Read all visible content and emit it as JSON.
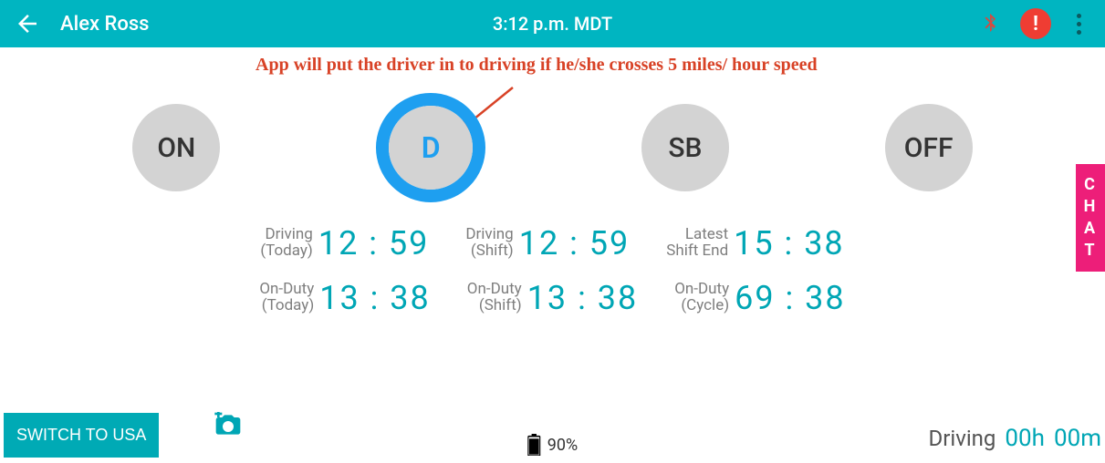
{
  "header": {
    "driver_name": "Alex Ross",
    "clock": "3:12 p.m. MDT"
  },
  "annotation": "App will put the driver in to driving if he/she crosses 5 miles/ hour speed",
  "status_buttons": {
    "on": "ON",
    "d": "D",
    "sb": "SB",
    "off": "OFF"
  },
  "times_row1": [
    {
      "label_line1": "Driving",
      "label_line2": "(Today)",
      "value": "12 : 59"
    },
    {
      "label_line1": "Driving",
      "label_line2": "(Shift)",
      "value": "12 : 59"
    },
    {
      "label_line1": "Latest",
      "label_line2": "Shift End",
      "value": "15 : 38"
    }
  ],
  "times_row2": [
    {
      "label_line1": "On-Duty",
      "label_line2": "(Today)",
      "value": "13 : 38"
    },
    {
      "label_line1": "On-Duty",
      "label_line2": "(Shift)",
      "value": "13 : 38"
    },
    {
      "label_line1": "On-Duty",
      "label_line2": "(Cycle)",
      "value": "69 : 38"
    }
  ],
  "bottom": {
    "switch_label": "SWITCH TO USA",
    "battery_pct": "90%",
    "driving_label": "Driving",
    "driving_hours": "00h",
    "driving_minutes": "00m"
  },
  "chat_tab": [
    "C",
    "H",
    "A",
    "T"
  ]
}
